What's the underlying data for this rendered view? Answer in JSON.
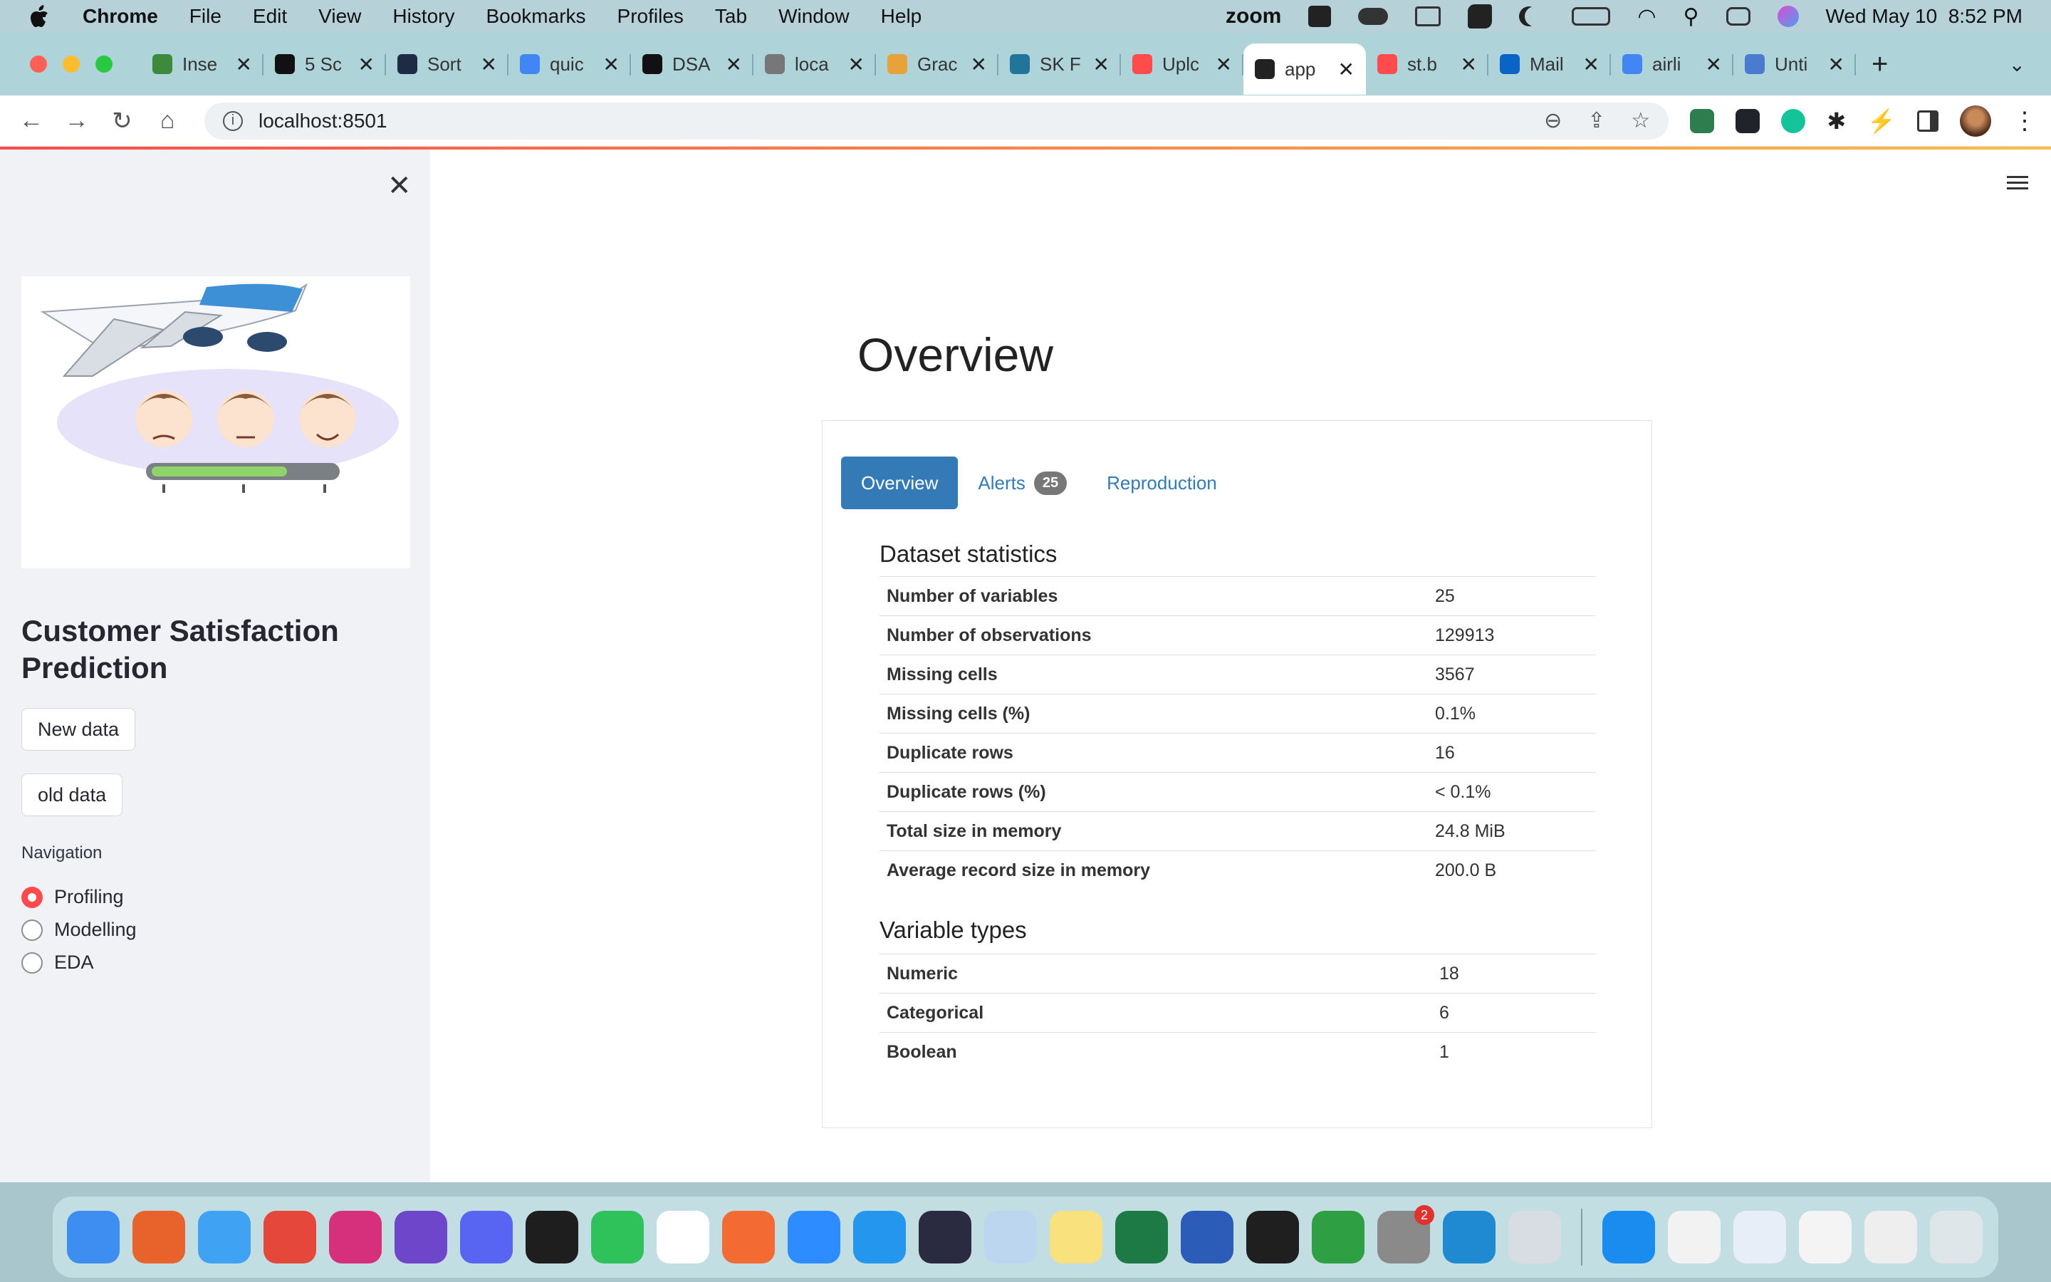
{
  "menubar": {
    "app_name": "Chrome",
    "items": [
      "File",
      "Edit",
      "View",
      "History",
      "Bookmarks",
      "Profiles",
      "Tab",
      "Window",
      "Help"
    ],
    "zoom_label": "zoom",
    "datetime": "Wed May 10  8:52 PM"
  },
  "tabs": [
    {
      "label": "Inse",
      "color": "#3c8a3c"
    },
    {
      "label": "5 Sc",
      "color": "#111111"
    },
    {
      "label": "Sort",
      "color": "#1f2a44"
    },
    {
      "label": "quic",
      "color": "#4285f4"
    },
    {
      "label": "DSA",
      "color": "#111111"
    },
    {
      "label": "loca",
      "color": "#777777"
    },
    {
      "label": "Grac",
      "color": "#e8a23a"
    },
    {
      "label": "SK F",
      "color": "#21759b"
    },
    {
      "label": "Uplc",
      "color": "#ff4b4b"
    },
    {
      "label": "app",
      "color": "#222222",
      "active": true
    },
    {
      "label": "st.b",
      "color": "#ff4b4b"
    },
    {
      "label": "Mail",
      "color": "#0a64c8"
    },
    {
      "label": "airli",
      "color": "#4285f4"
    },
    {
      "label": "Unti",
      "color": "#4a7bd0"
    }
  ],
  "address_bar": {
    "url": "localhost:8501"
  },
  "sidebar": {
    "title": "Customer Satisfaction Prediction",
    "buttons": {
      "new_data": "New data",
      "old_data": "old data"
    },
    "navigation_label": "Navigation",
    "radio_options": [
      "Profiling",
      "Modelling",
      "EDA"
    ],
    "selected": "Profiling"
  },
  "main": {
    "page_title": "Overview",
    "report_tabs": {
      "overview": "Overview",
      "alerts": "Alerts",
      "alerts_count": "25",
      "reproduction": "Reproduction"
    },
    "dataset_statistics": {
      "heading": "Dataset statistics",
      "rows": [
        {
          "label": "Number of variables",
          "value": "25"
        },
        {
          "label": "Number of observations",
          "value": "129913"
        },
        {
          "label": "Missing cells",
          "value": "3567"
        },
        {
          "label": "Missing cells (%)",
          "value": "0.1%"
        },
        {
          "label": "Duplicate rows",
          "value": "16"
        },
        {
          "label": "Duplicate rows (%)",
          "value": "< 0.1%"
        },
        {
          "label": "Total size in memory",
          "value": "24.8 MiB"
        },
        {
          "label": "Average record size in memory",
          "value": "200.0 B"
        }
      ]
    },
    "variable_types": {
      "heading": "Variable types",
      "rows": [
        {
          "label": "Numeric",
          "value": "18"
        },
        {
          "label": "Categorical",
          "value": "6"
        },
        {
          "label": "Boolean",
          "value": "1"
        }
      ]
    }
  },
  "dock": {
    "apps": [
      {
        "name": "finder",
        "color": "#3d8ef0"
      },
      {
        "name": "firefox",
        "color": "#e8632b"
      },
      {
        "name": "safari",
        "color": "#3fa2f2"
      },
      {
        "name": "chrome",
        "color": "#e5473b"
      },
      {
        "name": "intellij",
        "color": "#d62f7c"
      },
      {
        "name": "github-desktop",
        "color": "#6e46c9"
      },
      {
        "name": "discord",
        "color": "#5865f2"
      },
      {
        "name": "terminal",
        "color": "#1e1e1e"
      },
      {
        "name": "whatsapp",
        "color": "#2fc15a"
      },
      {
        "name": "slack",
        "color": "#ffffff"
      },
      {
        "name": "postman",
        "color": "#f36b32"
      },
      {
        "name": "zoom",
        "color": "#2d8cff"
      },
      {
        "name": "docker",
        "color": "#2496ed"
      },
      {
        "name": "screen-app",
        "color": "#2a2a40"
      },
      {
        "name": "simulator",
        "color": "#bcd6ef"
      },
      {
        "name": "notes",
        "color": "#f9e27d"
      },
      {
        "name": "excel",
        "color": "#1d7a44"
      },
      {
        "name": "word",
        "color": "#2b5cb8"
      },
      {
        "name": "pycharm",
        "color": "#1f1f1f"
      },
      {
        "name": "circle-app",
        "color": "#2ea043"
      },
      {
        "name": "system-settings",
        "color": "#8a8a8a",
        "badge": "2"
      },
      {
        "name": "vscode",
        "color": "#1f8ad2"
      },
      {
        "name": "preview",
        "color": "#d8dde4"
      }
    ],
    "recent": [
      {
        "name": "app-store",
        "color": "#1a8cf0"
      },
      {
        "name": "window-thumb-1",
        "color": "#f2f2f2"
      },
      {
        "name": "window-thumb-2",
        "color": "#e8eef8"
      },
      {
        "name": "window-thumb-3",
        "color": "#f4f4f4"
      },
      {
        "name": "window-thumb-4",
        "color": "#eeeeee"
      },
      {
        "name": "trash",
        "color": "#dfe6ea"
      }
    ]
  }
}
